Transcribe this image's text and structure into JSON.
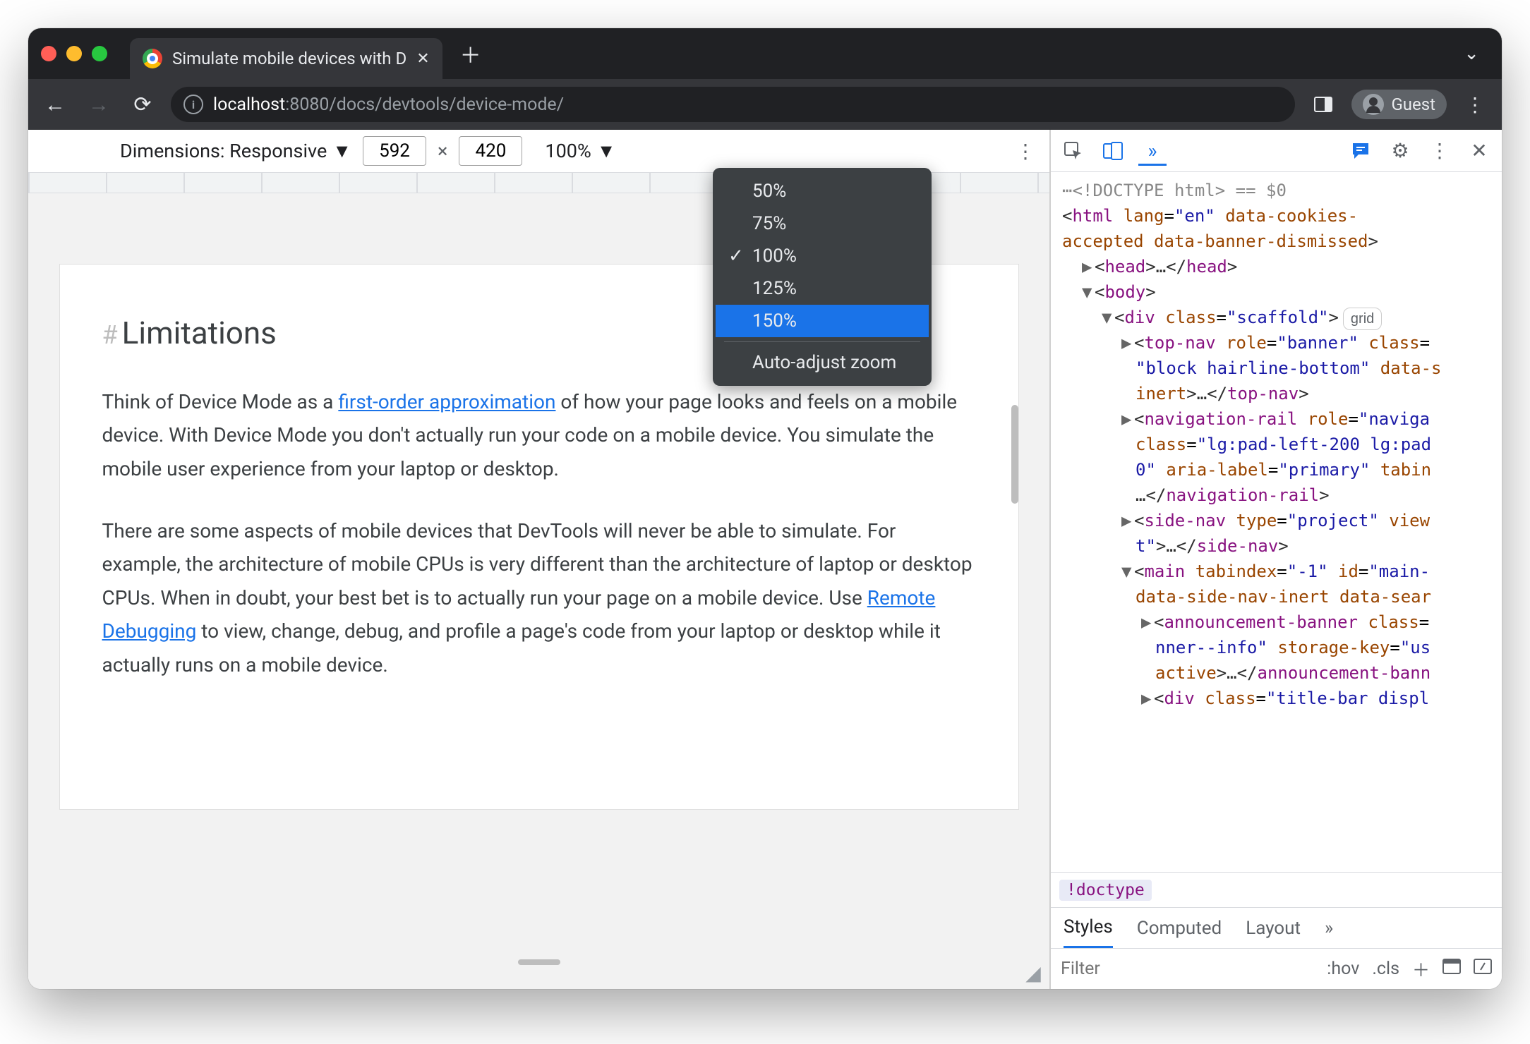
{
  "browser": {
    "tab_title": "Simulate mobile devices with D",
    "url_host": "localhost",
    "url_port": ":8080",
    "url_path": "/docs/devtools/device-mode/",
    "profile_label": "Guest"
  },
  "device_toolbar": {
    "dimensions_label": "Dimensions: Responsive",
    "width": "592",
    "height": "420",
    "zoom": "100%",
    "zoom_options": [
      "50%",
      "75%",
      "100%",
      "125%",
      "150%"
    ],
    "zoom_checked": "100%",
    "zoom_selected": "150%",
    "auto_adjust": "Auto-adjust zoom"
  },
  "page": {
    "heading": "Limitations",
    "p1_a": "Think of Device Mode as a ",
    "p1_link": "first-order approximation",
    "p1_b": " of how your page looks and feels on a mobile device. With Device Mode you don't actually run your code on a mobile device. You simulate the mobile user experience from your laptop or desktop.",
    "p2_a": "There are some aspects of mobile devices that DevTools will never be able to simulate. For example, the architecture of mobile CPUs is very different than the architecture of laptop or desktop CPUs. When in doubt, your best bet is to actually run your page on a mobile device. Use ",
    "p2_link": "Remote Debugging",
    "p2_b": " to view, change, debug, and profile a page's code from your laptop or desktop while it actually runs on a mobile device."
  },
  "devtools": {
    "doctype_comment": "<!DOCTYPE html>",
    "eq0": " == $0",
    "html_open": "<html lang=\"en\" data-cookies-accepted data-banner-dismissed>",
    "head": "<head>…</head>",
    "body_open": "<body>",
    "div_scaffold": "<div class=\"scaffold\">",
    "grid_badge": "grid",
    "topnav": "<top-nav role=\"banner\" class=\"block hairline-bottom\" data-s inert>…</top-nav>",
    "navrail": "<navigation-rail role=\"naviga class=\"lg:pad-left-200 lg:pad 0\" aria-label=\"primary\" tabin …</navigation-rail>",
    "sidenav": "<side-nav type=\"project\" view t\">…</side-nav>",
    "main": "<main tabindex=\"-1\" id=\"main-\" data-side-nav-inert data-sear",
    "announce": "<announcement-banner class=\"nner--info\" storage-key=\"us active>…</announcement-bann",
    "titlebar": "<div class=\"title-bar displ",
    "breadcrumb": "!doctype",
    "styles_tabs": {
      "styles": "Styles",
      "computed": "Computed",
      "layout": "Layout"
    },
    "filter_placeholder": "Filter",
    "hov": ":hov",
    "cls": ".cls"
  }
}
